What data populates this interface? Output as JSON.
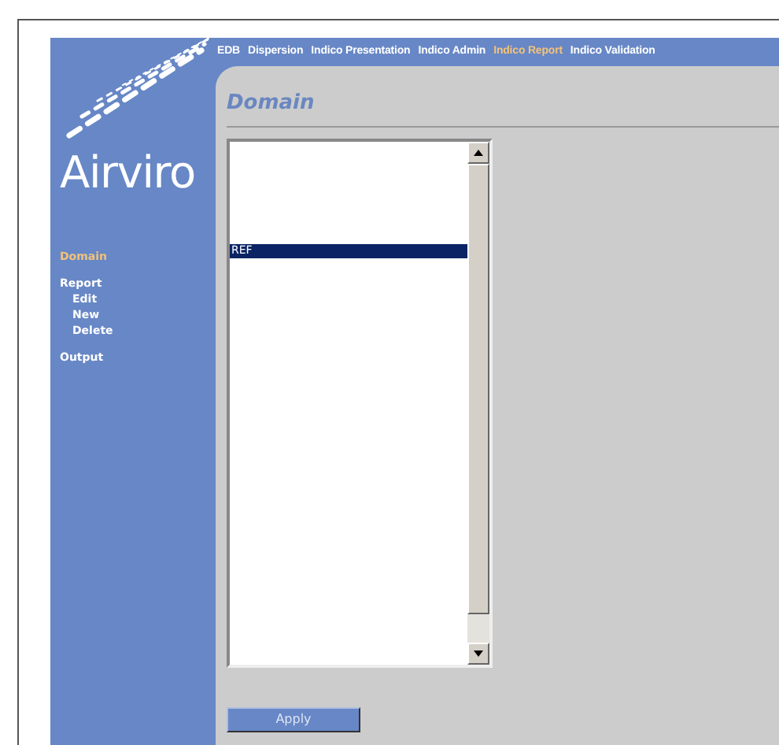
{
  "logo": {
    "text": "Airviro"
  },
  "nav": [
    {
      "label": "EDB",
      "selected": false
    },
    {
      "label": "Dispersion",
      "selected": false
    },
    {
      "label": "Indico Presentation",
      "selected": false
    },
    {
      "label": "Indico Admin",
      "selected": false
    },
    {
      "label": "Indico Report",
      "selected": true
    },
    {
      "label": "Indico Validation",
      "selected": false
    }
  ],
  "sidebar": {
    "items": [
      {
        "label": "Domain",
        "selected": true
      },
      {
        "label": "Report",
        "selected": false,
        "children": [
          {
            "label": "Edit",
            "selected": false
          },
          {
            "label": "New",
            "selected": false
          },
          {
            "label": "Delete",
            "selected": false
          }
        ]
      },
      {
        "label": "Output",
        "selected": false
      }
    ]
  },
  "panel": {
    "title": "Domain",
    "list": [
      {
        "label": "REF",
        "selected": true
      }
    ],
    "apply_button": "Apply"
  }
}
